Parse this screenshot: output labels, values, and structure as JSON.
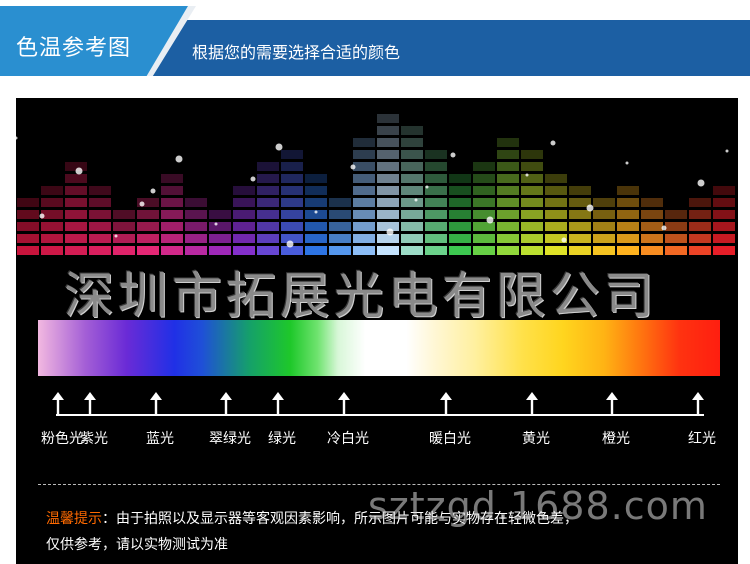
{
  "header": {
    "title": "色温参考图",
    "subtitle": "根据您的需要选择合适的颜色"
  },
  "watermark": {
    "company": "深圳市拓展光电有限公司",
    "site": "sztzgd.1688.com"
  },
  "spectrum_labels": [
    {
      "text": "粉色光"
    },
    {
      "text": "紫光"
    },
    {
      "text": "蓝光"
    },
    {
      "text": "翠绿光"
    },
    {
      "text": "绿光"
    },
    {
      "text": "冷白光"
    },
    {
      "text": "暖白光"
    },
    {
      "text": "黄光"
    },
    {
      "text": "橙光"
    },
    {
      "text": "红光"
    }
  ],
  "note": {
    "label": "温馨提示",
    "text": "：由于拍照以及显示器等客观因素影响，所示图片可能与实物存在轻微色差，",
    "text2": "仅供参考，请以实物测试为准"
  },
  "colors": {
    "header_bar": "#1c5fa3",
    "header_tab": "#2a8fd0",
    "note_label": "#ff6a00",
    "panel_bg": "#000000"
  }
}
